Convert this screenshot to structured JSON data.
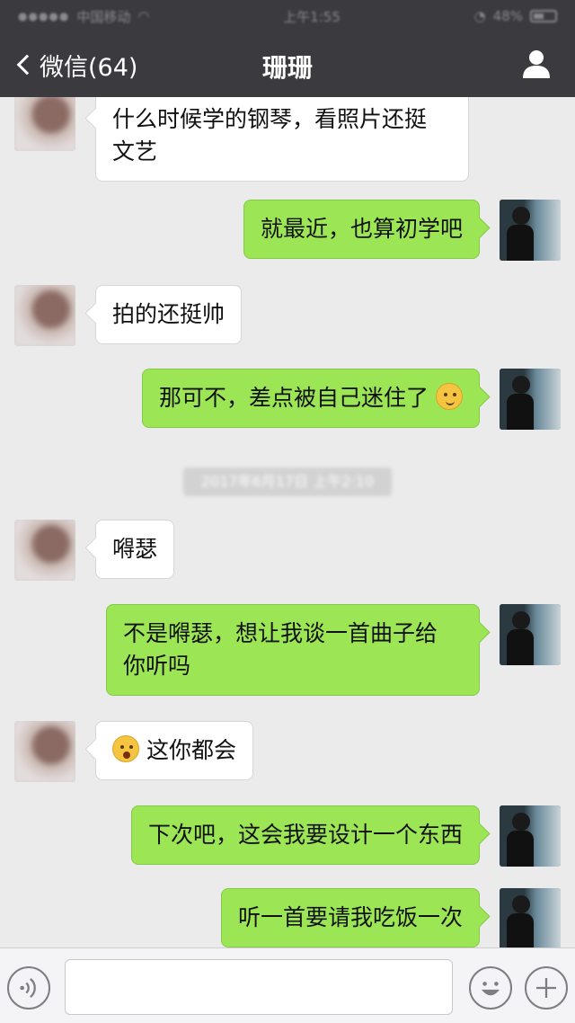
{
  "status_bar": {
    "carrier": "中国移动",
    "time": "上午1:55",
    "battery": "48%"
  },
  "nav": {
    "back_label": "微信(64)",
    "title": "珊珊"
  },
  "messages": [
    {
      "side": "in",
      "lines": [
        "什么时候学的钢琴，看照片还挺",
        "文艺"
      ]
    },
    {
      "side": "out",
      "lines": [
        "就最近，也算初学吧"
      ]
    },
    {
      "side": "in",
      "lines": [
        "拍的还挺帅"
      ]
    },
    {
      "side": "out",
      "lines": [
        "那可不，差点被自己迷住了"
      ],
      "trailing_emoji": "hehe-face-emoji"
    },
    {
      "side": "in",
      "lines": [
        "嘚瑟"
      ]
    },
    {
      "side": "out",
      "lines": [
        "不是嘚瑟，想让我谈一首曲子给",
        "你听吗"
      ]
    },
    {
      "side": "in",
      "lines": [
        "这你都会"
      ],
      "leading_emoji": "shocked-face-emoji"
    },
    {
      "side": "out",
      "lines": [
        "下次吧，这会我要设计一个东西"
      ]
    },
    {
      "side": "out",
      "lines": [
        "听一首要请我吃饭一次"
      ]
    }
  ],
  "timestamp": "2017年6月17日 上午2:10",
  "icons": {
    "back": "chevron-left-icon",
    "profile": "person-icon",
    "voice": "voice-icon",
    "emoji": "emoji-icon",
    "more": "plus-icon"
  },
  "colors": {
    "header_bg": "#3a3a3f",
    "chat_bg": "#ebebeb",
    "out_bubble": "#9ce554",
    "in_bubble": "#ffffff"
  }
}
